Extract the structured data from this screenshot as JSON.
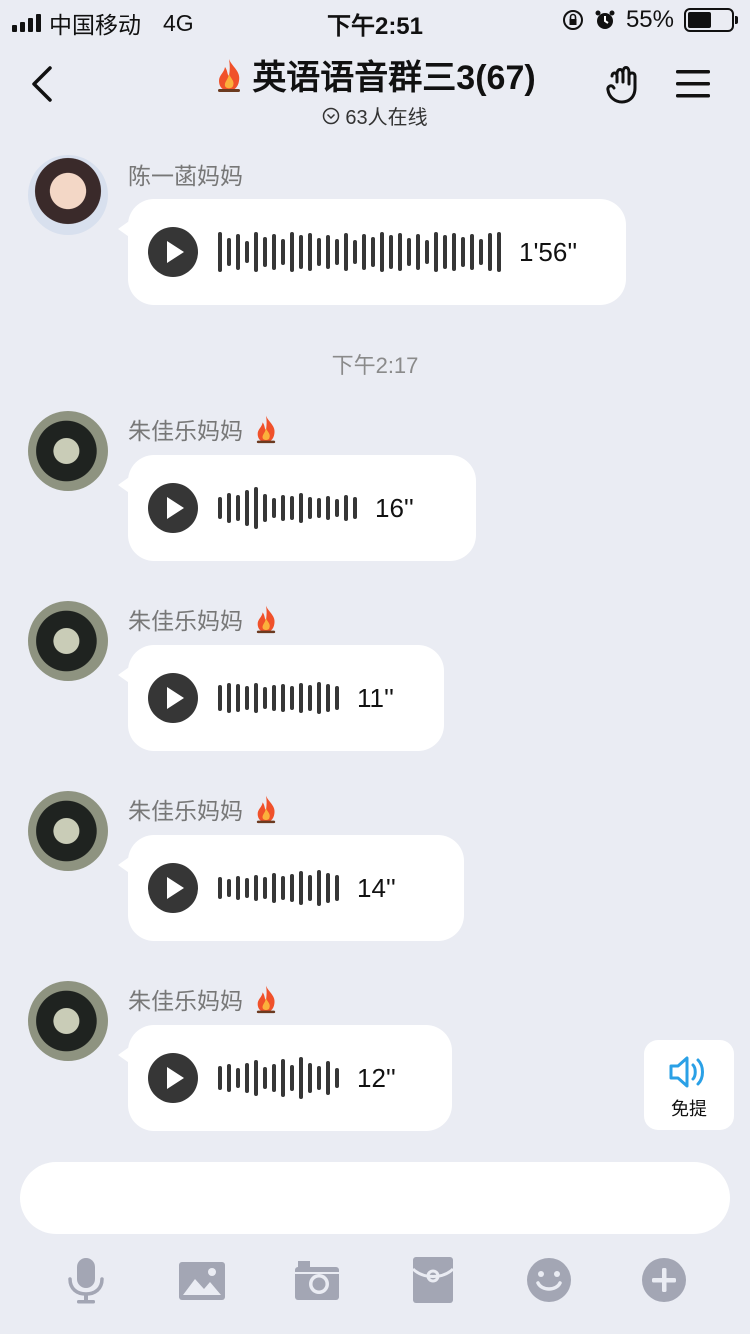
{
  "status_bar": {
    "carrier": "中国移动",
    "network": "4G",
    "time": "下午2:51",
    "battery_percent": "55%",
    "battery_level": 0.55
  },
  "header": {
    "title": "英语语音群三3(67)",
    "online": "63人在线",
    "title_icon": "fire-icon",
    "icons": [
      "back-chevron-icon",
      "hand-gesture-icon",
      "menu-icon"
    ]
  },
  "messages": [
    {
      "sender": "陈一菡妈妈",
      "duration": "1'56''",
      "has_fire": false
    },
    {
      "sender": "朱佳乐妈妈",
      "duration": "16''",
      "has_fire": true
    },
    {
      "sender": "朱佳乐妈妈",
      "duration": "11''",
      "has_fire": true
    },
    {
      "sender": "朱佳乐妈妈",
      "duration": "14''",
      "has_fire": true
    },
    {
      "sender": "朱佳乐妈妈",
      "duration": "12''",
      "has_fire": true
    }
  ],
  "time_separator": "下午2:17",
  "speaker_toggle": {
    "label": "免提",
    "icon": "speaker-icon"
  },
  "toolbar": {
    "icons": [
      "microphone-icon",
      "image-icon",
      "camera-icon",
      "red-packet-icon",
      "emoji-icon",
      "plus-icon"
    ]
  },
  "colors": {
    "background": "#eaecf3",
    "bubble": "#ffffff",
    "accent_blue": "#2aa0e6",
    "dark": "#363636"
  }
}
